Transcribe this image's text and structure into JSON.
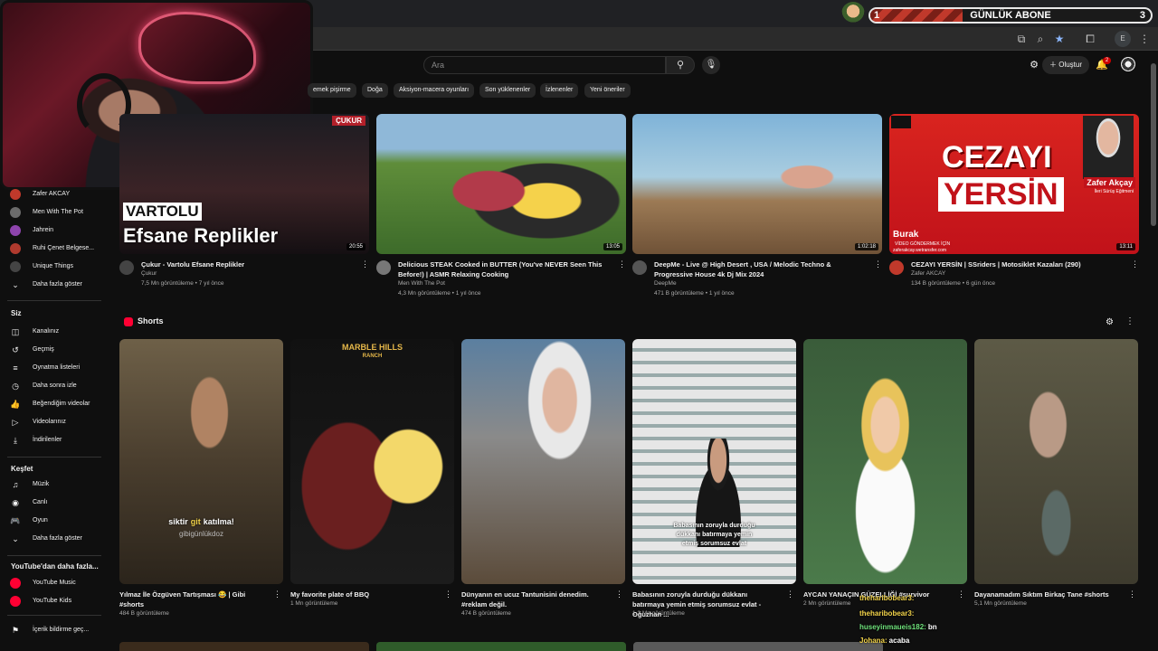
{
  "overlay": {
    "sub_counter": {
      "start": "1",
      "label": "GÜNLÜK ABONE",
      "goal": "3",
      "progress": 0.33
    }
  },
  "header": {
    "search_placeholder": "Ara",
    "create_label": "Oluştur",
    "notification_count": "2"
  },
  "chips": [
    "emek pişirme",
    "Doğa",
    "Aksiyon-macera oyunları",
    "Son yüklenenler",
    "İzlenenler",
    "Yeni öneriler"
  ],
  "sidebar": {
    "subscriptions": [
      {
        "label": "Zafer AKCAY",
        "color": "#c0392b"
      },
      {
        "label": "Men With The Pot",
        "color": "#6b6b6b"
      },
      {
        "label": "Jahrein",
        "color": "#8e44ad"
      },
      {
        "label": "Ruhi Çenet Belgese...",
        "color": "#b03a2e"
      },
      {
        "label": "Unique Things",
        "color": "#444"
      }
    ],
    "show_more_1": "Daha fazla göster",
    "you_header": "Siz",
    "you_items": [
      "Kanalınız",
      "Geçmiş",
      "Oynatma listeleri",
      "Daha sonra izle",
      "Beğendiğim videolar",
      "Videolarınız",
      "İndirilenler"
    ],
    "explore_header": "Keşfet",
    "explore_items": [
      "Müzik",
      "Canlı",
      "Oyun"
    ],
    "show_more_2": "Daha fazla göster",
    "more_header": "YouTube'dan daha fazla...",
    "more_items": [
      "YouTube Music",
      "YouTube Kids"
    ],
    "report_item": "İçerik bildirme geç..."
  },
  "videos": [
    {
      "title_line1": "Çukur - Vartolu Efsane Replikler",
      "title_line2": "",
      "channel": "Çukur",
      "meta": "7,5 Mn görüntüleme • 7 yıl önce",
      "duration": "20:55",
      "overlay_top": "VARTOLU",
      "overlay_bottom": "Efsane Replikler",
      "badge": "ÇUKUR"
    },
    {
      "title_line1": "Delicious STEAK Cooked in BUTTER (You've NEVER Seen This",
      "title_line2": "Before!) | ASMR Relaxing Cooking",
      "channel": "Men With The Pot",
      "meta": "4,3 Mn görüntüleme • 1 yıl önce",
      "duration": "13:05"
    },
    {
      "title_line1": "DeepMe - Live @ High Desert , USA / Melodic Techno &",
      "title_line2": "Progressive House 4k Dj Mix 2024",
      "channel": "DeepMe",
      "meta": "471 B görüntüleme • 1 yıl önce",
      "duration": "1:02:18"
    },
    {
      "title_line1": "CEZAYI YERSİN | SSriders | Motosiklet Kazaları (290)",
      "title_line2": "",
      "channel": "Zafer AKCAY",
      "meta": "134 B görüntüleme • 6 gün önce",
      "duration": "13:11",
      "overlay_top": "CEZAYI",
      "overlay_bottom": "YERSİN",
      "badge": "Zafer Akçay",
      "badge_sub": "İleri Sürüş Eğitmeni",
      "corner_name": "Burak",
      "corner_sub": "VİDEO GÖNDERMEK İÇİN",
      "corner_site": "zaferakcay.wetransfer.com"
    }
  ],
  "shorts_section": {
    "title": "Shorts"
  },
  "shorts": [
    {
      "title": "Yılmaz İle Özgüven Tartışması 😂 | Gibi #shorts",
      "views": "484 B görüntüleme",
      "caption1": "siktir",
      "caption_hl": "git",
      "caption2": "katılma!",
      "caption3": "gibigünlükdoz"
    },
    {
      "title": "My favorite plate of BBQ",
      "views": "1 Mn görüntüleme",
      "caption1": "MARBLE HILLS",
      "caption2": "RANCH"
    },
    {
      "title": "Dünyanın en ucuz Tantunisini denedim. #reklam değil.",
      "views": "474 B görüntüleme"
    },
    {
      "title": "Babasının zoruyla durduğu dükkanı batırmaya yemin etmiş sorumsuz evlat - Oğuzhan ...",
      "views": "1,2 Mn görüntüleme",
      "caption1": "Babasının zoruyla durduğu",
      "caption2": "dükkanı batırmaya yemin",
      "caption3": "etmiş sorumsuz evlat"
    },
    {
      "title": "AYCAN YANAÇIN GÜZELLİĞİ #survivor",
      "views": "2 Mn görüntüleme"
    },
    {
      "title": "Dayanamadım Sıktım Birkaç Tane #shorts",
      "views": "5,1 Mn görüntüleme"
    }
  ],
  "chat": [
    {
      "user": "theharibobear3:",
      "msg": "",
      "color": "#f3d44a"
    },
    {
      "user": "theharibobear3:",
      "msg": "",
      "color": "#f3d44a"
    },
    {
      "user": "huseyinmaueis182:",
      "msg": "bn",
      "color": "#6ee07a"
    },
    {
      "user": "Johana:",
      "msg": "acaba",
      "color": "#f3d44a"
    }
  ]
}
